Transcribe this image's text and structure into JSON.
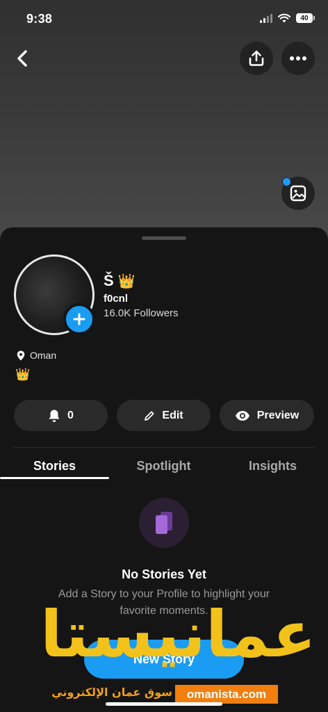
{
  "status_bar": {
    "time": "9:38",
    "battery": "40"
  },
  "profile": {
    "display_name": "Š",
    "display_emoji": "👑",
    "username": "f0cnl",
    "followers": "16.0K Followers",
    "location": "Oman",
    "bio": "👑"
  },
  "actions": {
    "notifications_count": "0",
    "edit_label": "Edit",
    "preview_label": "Preview"
  },
  "tabs": [
    {
      "label": "Stories",
      "active": true
    },
    {
      "label": "Spotlight",
      "active": false
    },
    {
      "label": "Insights",
      "active": false
    }
  ],
  "empty_state": {
    "title": "No Stories Yet",
    "description": "Add a Story to your Profile to highlight your favorite moments.",
    "button_label": "New Story"
  },
  "watermark": {
    "arabic_title": "عمانيستا",
    "arabic_tagline": "سوق عمان الإلكتروني",
    "url": "omanista.com"
  },
  "colors": {
    "accent_blue": "#1a9cf2",
    "sheet_bg": "#151515",
    "button_bg": "#2a2a2a",
    "watermark_yellow": "#f2c21b",
    "watermark_orange": "#f07f10"
  },
  "icons": [
    "back-chevron-icon",
    "share-upload-icon",
    "more-dots-icon",
    "bitmoji-gallery-icon",
    "plus-icon",
    "location-pin-icon",
    "bell-icon",
    "pencil-icon",
    "eye-icon",
    "stories-cards-icon"
  ]
}
